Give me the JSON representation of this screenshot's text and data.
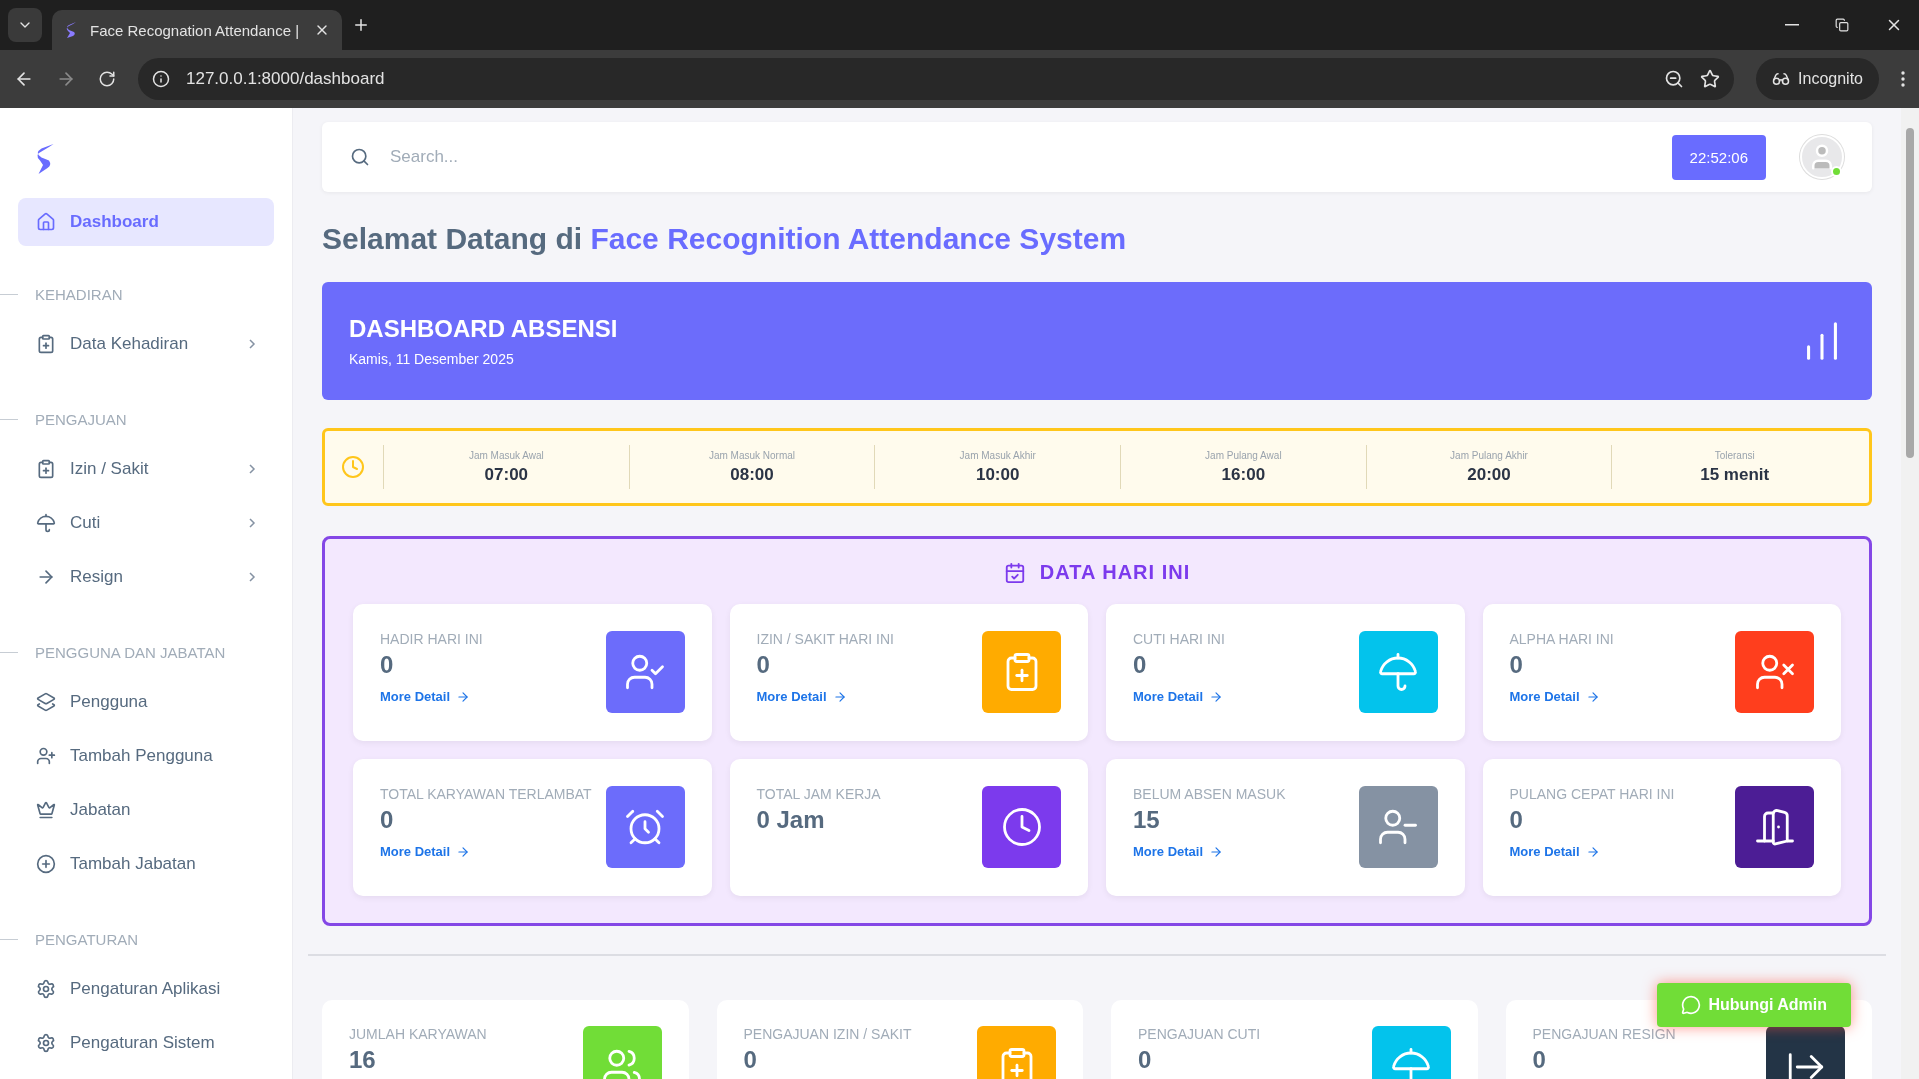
{
  "browser": {
    "tab_title": "Face Recognation Attendance |",
    "url": "127.0.0.1:8000/dashboard",
    "incognito_label": "Incognito"
  },
  "sidebar": {
    "sections": [
      {
        "items": [
          {
            "label": "Dashboard",
            "selected": true,
            "expandable": false
          }
        ]
      },
      {
        "heading": "KEHADIRAN",
        "items": [
          {
            "label": "Data Kehadiran",
            "selected": false,
            "expandable": true
          }
        ]
      },
      {
        "heading": "PENGAJUAN",
        "items": [
          {
            "label": "Izin / Sakit",
            "selected": false,
            "expandable": true
          },
          {
            "label": "Cuti",
            "selected": false,
            "expandable": true
          },
          {
            "label": "Resign",
            "selected": false,
            "expandable": true
          }
        ]
      },
      {
        "heading": "PENGGUNA DAN JABATAN",
        "items": [
          {
            "label": "Pengguna",
            "selected": false,
            "expandable": false
          },
          {
            "label": "Tambah Pengguna",
            "selected": false,
            "expandable": false
          },
          {
            "label": "Jabatan",
            "selected": false,
            "expandable": false
          },
          {
            "label": "Tambah Jabatan",
            "selected": false,
            "expandable": false
          }
        ]
      },
      {
        "heading": "PENGATURAN",
        "items": [
          {
            "label": "Pengaturan Aplikasi",
            "selected": false,
            "expandable": false
          },
          {
            "label": "Pengaturan Sistem",
            "selected": false,
            "expandable": false
          }
        ]
      }
    ]
  },
  "topbar": {
    "search": {
      "placeholder": "Search..."
    },
    "clock": "22:52:06",
    "user_online": true
  },
  "welcome": {
    "prefix": "Selamat Datang di",
    "highlight": "Face Recognition Attendance System"
  },
  "banner": {
    "title": "DASHBOARD ABSENSI",
    "date": "Kamis, 11 Desember 2025"
  },
  "schedule": [
    {
      "label": "Jam Masuk Awal",
      "value": "07:00"
    },
    {
      "label": "Jam Masuk Normal",
      "value": "08:00"
    },
    {
      "label": "Jam Masuk Akhir",
      "value": "10:00"
    },
    {
      "label": "Jam Pulang Awal",
      "value": "16:00"
    },
    {
      "label": "Jam Pulang Akhir",
      "value": "20:00"
    },
    {
      "label": "Toleransi",
      "value": "15 menit"
    }
  ],
  "today": {
    "title": "DATA HARI INI",
    "cards": [
      {
        "label": "HADIR HARI INI",
        "value": "0",
        "link": "More Detail",
        "color": "#6c6cfb"
      },
      {
        "label": "IZIN / SAKIT HARI INI",
        "value": "0",
        "link": "More Detail",
        "color": "#ffab00"
      },
      {
        "label": "CUTI HARI INI",
        "value": "0",
        "link": "More Detail",
        "color": "#03c3ec"
      },
      {
        "label": "ALPHA HARI INI",
        "value": "0",
        "link": "More Detail",
        "color": "#ff3e1d"
      },
      {
        "label": "TOTAL KARYAWAN TERLAMBAT",
        "value": "0",
        "link": "More Detail",
        "color": "#6c6cfb"
      },
      {
        "label": "TOTAL JAM KERJA",
        "value": "0 Jam",
        "color": "#7c3aed"
      },
      {
        "label": "BELUM ABSEN MASUK",
        "value": "15",
        "link": "More Detail",
        "color": "#8592a3"
      },
      {
        "label": "PULANG CEPAT HARI INI",
        "value": "0",
        "link": "More Detail",
        "color": "#4c1d95"
      }
    ]
  },
  "summary": [
    {
      "label": "JUMLAH KARYAWAN",
      "value": "16",
      "color": "#71dd37"
    },
    {
      "label": "PENGAJUAN IZIN / SAKIT",
      "value": "0",
      "color": "#ffab00"
    },
    {
      "label": "PENGAJUAN CUTI",
      "value": "0",
      "color": "#03c3ec"
    },
    {
      "label": "PENGAJUAN RESIGN",
      "value": "0",
      "color": "#233446"
    }
  ],
  "help_button": "Hubungi Admin"
}
